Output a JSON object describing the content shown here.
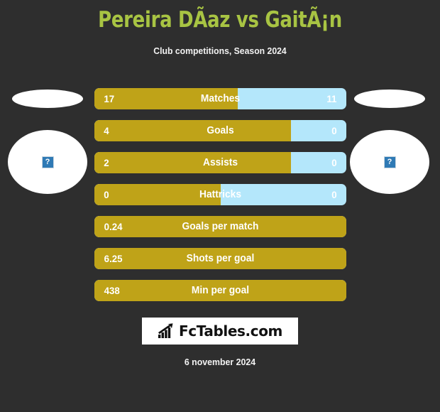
{
  "header": {
    "title": "Pereira DÃ­az vs GaitÃ¡n",
    "subtitle": "Club competitions, Season 2024",
    "title_color": "#a8c443"
  },
  "players": {
    "left": {
      "flag_alt": "",
      "photo_alt": "?"
    },
    "right": {
      "flag_alt": "",
      "photo_alt": "?"
    }
  },
  "colors": {
    "background": "#2e2e2e",
    "home_bar": "#bfa318",
    "away_bar": "#b4e7fb",
    "value_text": "#ffffff"
  },
  "stats": [
    {
      "label": "Matches",
      "home": "17",
      "away": "11",
      "home_pct": 57,
      "dual": true
    },
    {
      "label": "Goals",
      "home": "4",
      "away": "0",
      "home_pct": 78,
      "dual": true
    },
    {
      "label": "Assists",
      "home": "2",
      "away": "0",
      "home_pct": 78,
      "dual": true
    },
    {
      "label": "Hattricks",
      "home": "0",
      "away": "0",
      "home_pct": 50,
      "dual": true
    },
    {
      "label": "Goals per match",
      "home": "0.24",
      "away": "",
      "home_pct": 100,
      "dual": false
    },
    {
      "label": "Shots per goal",
      "home": "6.25",
      "away": "",
      "home_pct": 100,
      "dual": false
    },
    {
      "label": "Min per goal",
      "home": "438",
      "away": "",
      "home_pct": 100,
      "dual": false
    }
  ],
  "logo": {
    "text": "FcTables.com",
    "icon": "bar-chart-icon"
  },
  "footer": {
    "date": "6 november 2024"
  }
}
